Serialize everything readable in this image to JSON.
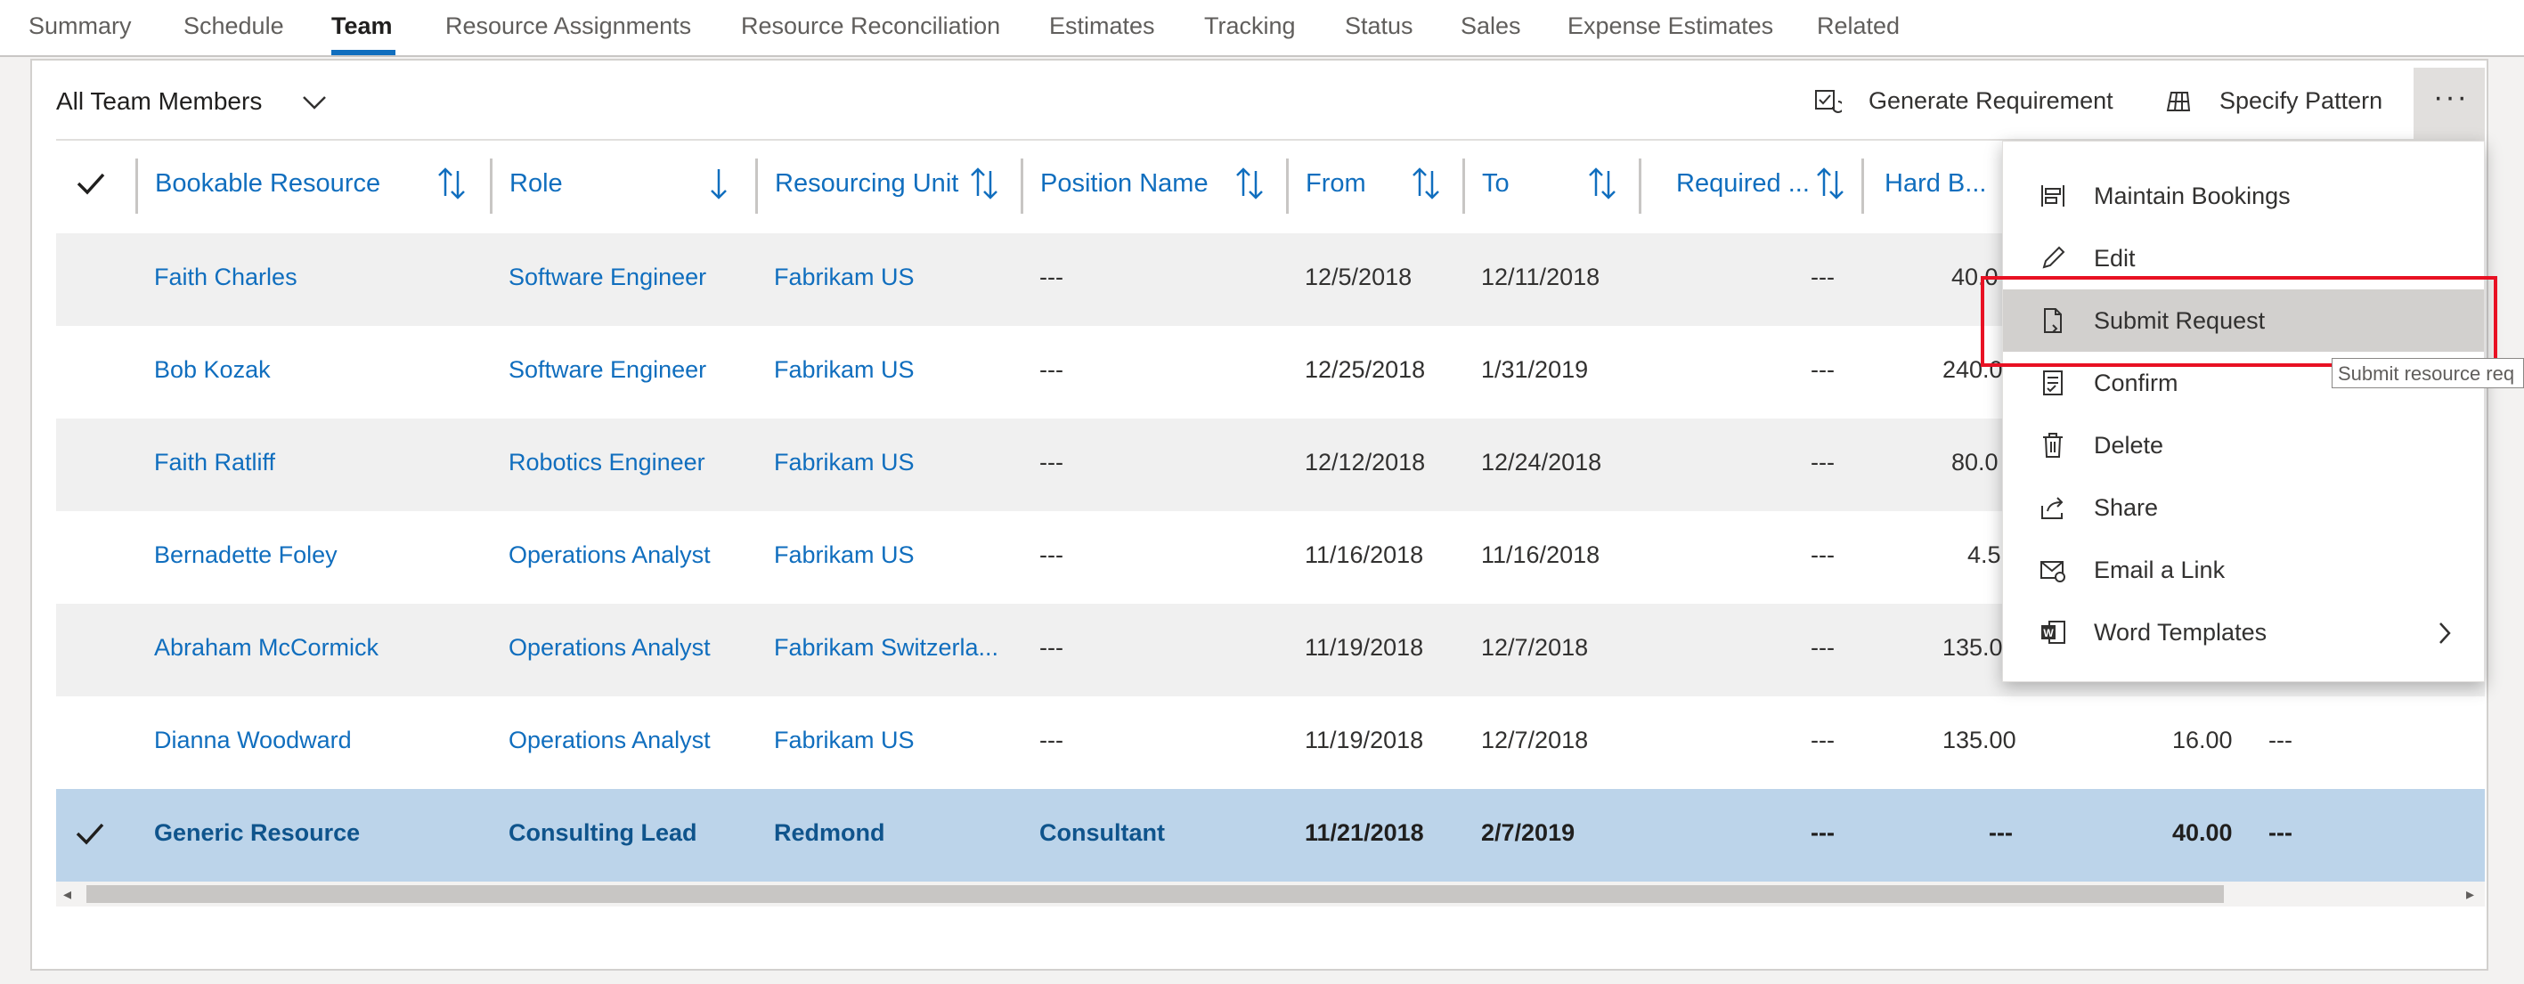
{
  "tabs": [
    "Summary",
    "Schedule",
    "Team",
    "Resource Assignments",
    "Resource Reconciliation",
    "Estimates",
    "Tracking",
    "Status",
    "Sales",
    "Expense Estimates",
    "Related"
  ],
  "view": {
    "title": "All Team Members"
  },
  "commands": {
    "generate": "Generate Requirement",
    "pattern": "Specify Pattern",
    "more": "···"
  },
  "columns": [
    "Bookable Resource",
    "Role",
    "Resourcing Unit",
    "Position Name",
    "From",
    "To",
    "Required ...",
    "Hard B..."
  ],
  "rows": [
    {
      "resource": "Faith Charles",
      "role": "Software Engineer",
      "unit": "Fabrikam US",
      "position": "---",
      "from": "12/5/2018",
      "to": "12/11/2018",
      "required": "---",
      "hard": "40.0",
      "extra": "",
      "dash": ""
    },
    {
      "resource": "Bob Kozak",
      "role": "Software Engineer",
      "unit": "Fabrikam US",
      "position": "---",
      "from": "12/25/2018",
      "to": "1/31/2019",
      "required": "---",
      "hard": "240.0",
      "extra": "",
      "dash": ""
    },
    {
      "resource": "Faith Ratliff",
      "role": "Robotics Engineer",
      "unit": "Fabrikam US",
      "position": "---",
      "from": "12/12/2018",
      "to": "12/24/2018",
      "required": "---",
      "hard": "80.0",
      "extra": "",
      "dash": ""
    },
    {
      "resource": "Bernadette Foley",
      "role": "Operations Analyst",
      "unit": "Fabrikam US",
      "position": "---",
      "from": "11/16/2018",
      "to": "11/16/2018",
      "required": "---",
      "hard": "4.5",
      "extra": "",
      "dash": ""
    },
    {
      "resource": "Abraham McCormick",
      "role": "Operations Analyst",
      "unit": "Fabrikam Switzerla...",
      "position": "---",
      "from": "11/19/2018",
      "to": "12/7/2018",
      "required": "---",
      "hard": "135.0",
      "extra": "",
      "dash": ""
    },
    {
      "resource": "Dianna Woodward",
      "role": "Operations Analyst",
      "unit": "Fabrikam US",
      "position": "---",
      "from": "11/19/2018",
      "to": "12/7/2018",
      "required": "---",
      "hard": "135.00",
      "extra": "16.00",
      "dash": "---"
    },
    {
      "resource": "Generic Resource",
      "role": "Consulting Lead",
      "unit": "Redmond",
      "position": "Consultant",
      "from": "11/21/2018",
      "to": "2/7/2019",
      "required": "---",
      "hard": "---",
      "extra": "40.00",
      "dash": "---"
    }
  ],
  "menu": {
    "items": [
      "Maintain Bookings",
      "Edit",
      "Submit Request",
      "Confirm",
      "Delete",
      "Share",
      "Email a Link",
      "Word Templates"
    ],
    "tooltip": "Submit resource req"
  },
  "colors": {
    "accent": "#106ebe",
    "selected_row": "#bcd4ea",
    "highlight": "#e81123"
  }
}
